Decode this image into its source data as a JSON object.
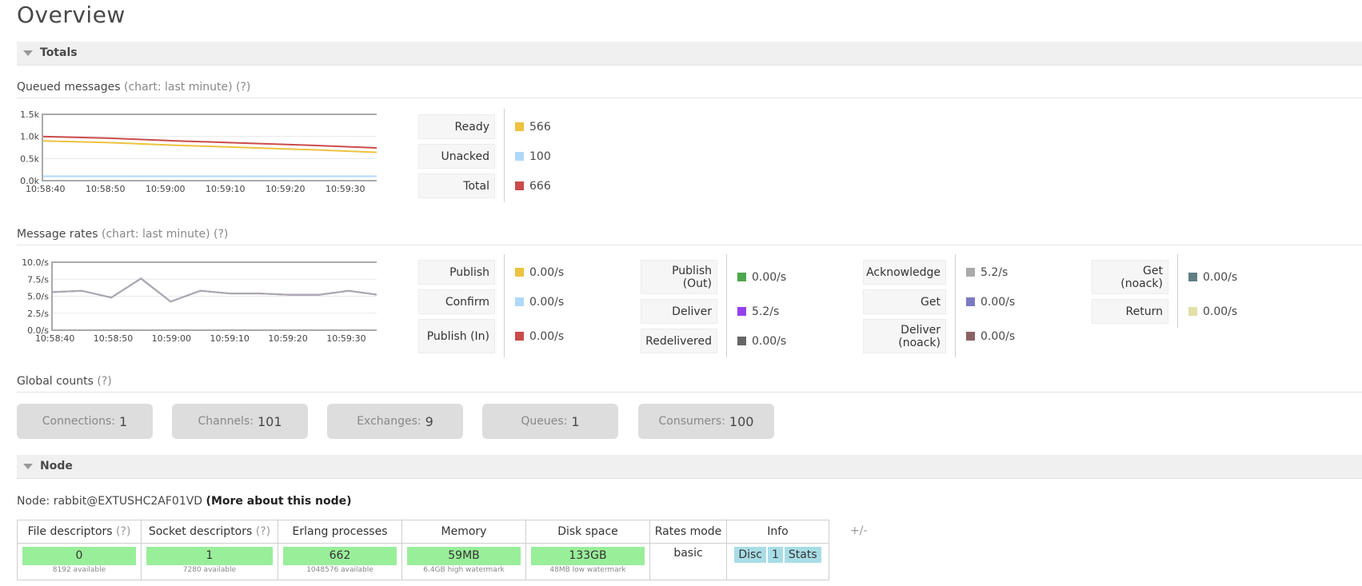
{
  "page": {
    "title": "Overview"
  },
  "totals_section": {
    "label": "Totals"
  },
  "queued": {
    "heading": "Queued messages",
    "chart_note": "(chart: last minute)",
    "help": "(?)",
    "stats": [
      {
        "label": "Ready",
        "value": "566",
        "color": "#edc240"
      },
      {
        "label": "Unacked",
        "value": "100",
        "color": "#afd8f8"
      },
      {
        "label": "Total",
        "value": "666",
        "color": "#cb4b4b"
      }
    ]
  },
  "rates": {
    "heading": "Message rates",
    "chart_note": "(chart: last minute)",
    "help": "(?)",
    "col1": [
      {
        "label": "Publish",
        "value": "0.00/s",
        "color": "#edc240"
      },
      {
        "label": "Confirm",
        "value": "0.00/s",
        "color": "#afd8f8"
      },
      {
        "label": "Publish (In)",
        "value": "0.00/s",
        "color": "#cb4b4b"
      }
    ],
    "col2": [
      {
        "label": "Publish (Out)",
        "value": "0.00/s",
        "color": "#4da74d"
      },
      {
        "label": "Deliver",
        "value": "5.2/s",
        "color": "#9440ed"
      },
      {
        "label": "Redelivered",
        "value": "0.00/s",
        "color": "#666666"
      }
    ],
    "col3": [
      {
        "label": "Acknowledge",
        "value": "5.2/s",
        "color": "#aaaaaa"
      },
      {
        "label": "Get",
        "value": "0.00/s",
        "color": "#7c79c3"
      },
      {
        "label": "Deliver (noack)",
        "value": "0.00/s",
        "color": "#8d6262"
      }
    ],
    "col4": [
      {
        "label": "Get (noack)",
        "value": "0.00/s",
        "color": "#5f7f85"
      },
      {
        "label": "Return",
        "value": "0.00/s",
        "color": "#e2e0a6"
      }
    ]
  },
  "global_counts": {
    "heading": "Global counts",
    "help": "(?)",
    "items": [
      {
        "label": "Connections:",
        "value": "1"
      },
      {
        "label": "Channels:",
        "value": "101"
      },
      {
        "label": "Exchanges:",
        "value": "9"
      },
      {
        "label": "Queues:",
        "value": "1"
      },
      {
        "label": "Consumers:",
        "value": "100"
      }
    ]
  },
  "node_section": {
    "label": "Node"
  },
  "node": {
    "prefix": "Node: rabbit@EXTUSHC2AF01VD",
    "more_link": "(More about this node)",
    "plus_minus": "+/-",
    "headers": {
      "file_descriptors": "File descriptors",
      "socket_descriptors": "Socket descriptors",
      "erlang_processes": "Erlang processes",
      "memory": "Memory",
      "disk_space": "Disk space",
      "rates_mode": "Rates mode",
      "info": "Info",
      "help": "(?)"
    },
    "file_descriptors": {
      "value": "0",
      "sub": "8192 available"
    },
    "socket_descriptors": {
      "value": "1",
      "sub": "7280 available"
    },
    "erlang_processes": {
      "value": "662",
      "sub": "1048576 available"
    },
    "memory": {
      "value": "59MB",
      "sub": "6.4GB high watermark"
    },
    "disk_space": {
      "value": "133GB",
      "sub": "48MB low watermark"
    },
    "rates_mode": "basic",
    "info_tags": [
      "Disc",
      "1",
      "Stats"
    ]
  },
  "chart_data": [
    {
      "type": "line",
      "x": [
        "10:58:40",
        "10:58:50",
        "10:59:00",
        "10:59:10",
        "10:59:20",
        "10:59:30"
      ],
      "ylim": [
        0,
        1500
      ],
      "yticks": [
        "0.0k",
        "0.5k",
        "1.0k",
        "1.5k"
      ],
      "series": [
        {
          "name": "Ready",
          "color": "#edc240",
          "values": [
            900,
            860,
            800,
            750,
            700,
            640
          ]
        },
        {
          "name": "Unacked",
          "color": "#afd8f8",
          "values": [
            100,
            100,
            100,
            100,
            100,
            100
          ]
        },
        {
          "name": "Total",
          "color": "#cb4b4b",
          "values": [
            1000,
            960,
            900,
            850,
            800,
            740
          ]
        }
      ]
    },
    {
      "type": "line",
      "x": [
        "10:58:40",
        "10:58:50",
        "10:59:00",
        "10:59:10",
        "10:59:20",
        "10:59:30"
      ],
      "ylim": [
        0,
        10
      ],
      "yticks": [
        "0.0/s",
        "2.5/s",
        "5.0/s",
        "7.5/s",
        "10.0/s"
      ],
      "series": [
        {
          "name": "Deliver",
          "color": "#9440ed",
          "values": [
            5.6,
            5.8,
            4.8,
            7.6,
            4.2,
            5.8,
            5.4,
            5.4,
            5.2,
            5.2,
            5.8,
            5.2
          ]
        },
        {
          "name": "Acknowledge",
          "color": "#aaaaaa",
          "values": [
            5.6,
            5.8,
            4.8,
            7.6,
            4.2,
            5.8,
            5.4,
            5.4,
            5.2,
            5.2,
            5.8,
            5.2
          ]
        },
        {
          "name": "Publish",
          "color": "#edc240",
          "values": [
            0,
            0,
            0,
            0,
            0,
            0,
            0,
            0,
            0,
            0,
            0,
            0
          ]
        }
      ]
    }
  ]
}
